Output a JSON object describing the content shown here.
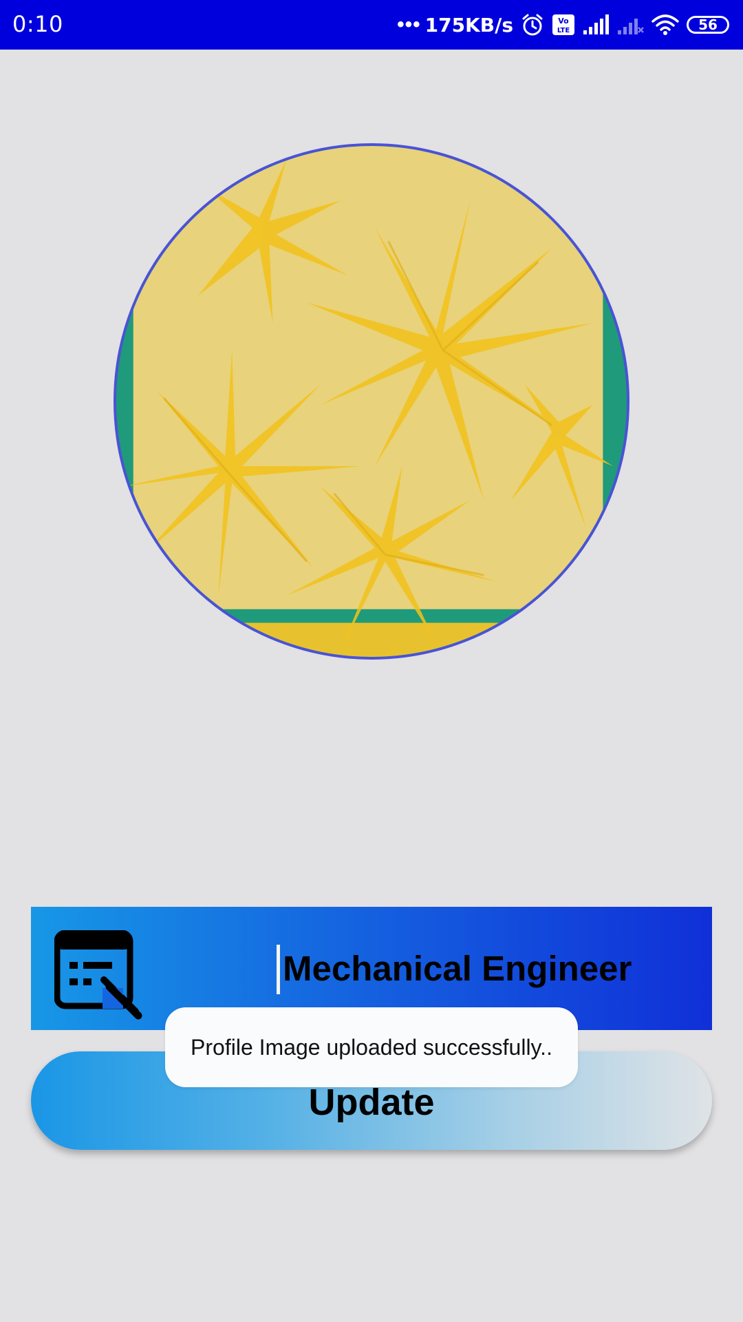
{
  "status_bar": {
    "time": "0:10",
    "network_speed": "175KB/s",
    "battery_level": "56",
    "icons": [
      "more-dots-icon",
      "alarm-icon",
      "volte-icon",
      "signal-icon",
      "signal-off-icon",
      "wifi-icon",
      "battery-icon"
    ],
    "volte_label": "Vo LTE",
    "background_color": "#0000dc"
  },
  "profile": {
    "image_description_icon": "profile-image",
    "border_color": "#4a52d6"
  },
  "designation": {
    "icon": "edit-designation-icon",
    "value": "Mechanical Engineer"
  },
  "actions": {
    "update_label": "Update"
  },
  "toast": {
    "message": "Profile Image uploaded successfully.."
  }
}
